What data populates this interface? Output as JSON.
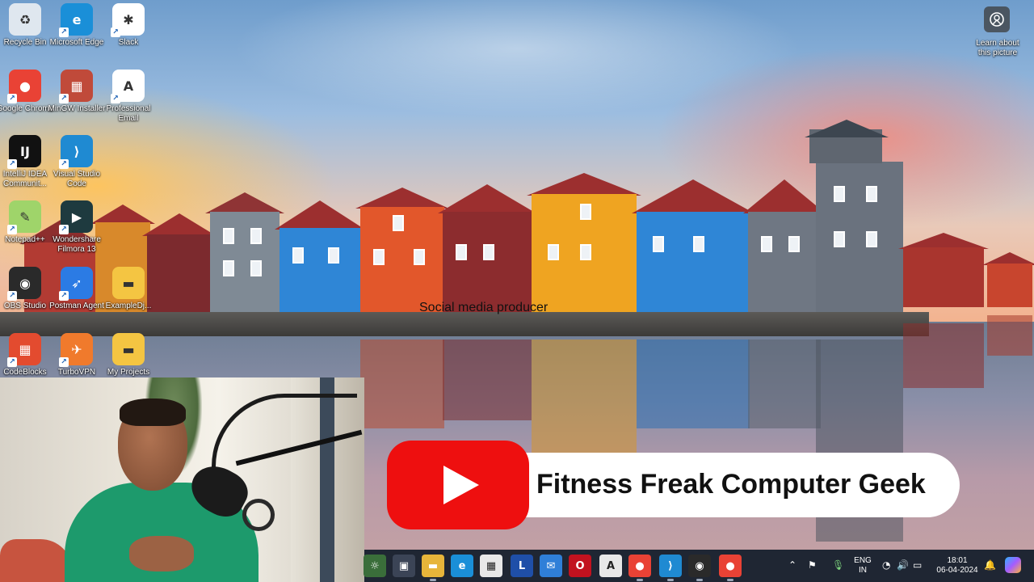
{
  "desktop": {
    "icons": [
      {
        "label": "Recycle Bin",
        "icon": "recycle-bin-icon",
        "color": "#dfe7ef"
      },
      {
        "label": "Microsoft Edge",
        "icon": "edge-icon",
        "color": "#1a8fd8"
      },
      {
        "label": "Slack",
        "icon": "slack-icon",
        "color": "#ffffff"
      },
      {
        "label": "Google Chrome",
        "icon": "chrome-icon",
        "color": "#e94235"
      },
      {
        "label": "MinGW Installer",
        "icon": "mingw-icon",
        "color": "#c04a3a"
      },
      {
        "label": "Professional Email",
        "icon": "email-icon",
        "color": "#ffffff"
      },
      {
        "label": "IntelliJ IDEA Communit...",
        "icon": "intellij-icon",
        "color": "#111111"
      },
      {
        "label": "Visual Studio Code",
        "icon": "vscode-icon",
        "color": "#1f8ad2"
      },
      {
        "label": "Notepad++",
        "icon": "notepadpp-icon",
        "color": "#9fd46a"
      },
      {
        "label": "Wondershare Filmora 13",
        "icon": "filmora-icon",
        "color": "#1e3a3f"
      },
      {
        "label": "OBS Studio",
        "icon": "obs-icon",
        "color": "#2a2a2a"
      },
      {
        "label": "Postman Agent",
        "icon": "postman-icon",
        "color": "#2b7be4"
      },
      {
        "label": "ExampleDj...",
        "icon": "folder-icon",
        "color": "#f4c542"
      },
      {
        "label": "CodeBlocks",
        "icon": "codeblocks-icon",
        "color": "#e34b2f"
      },
      {
        "label": "TurboVPN",
        "icon": "turbovpn-icon",
        "color": "#f07a2c"
      },
      {
        "label": "My Projects",
        "icon": "folder-icon",
        "color": "#f4c542"
      }
    ],
    "learn_label": "Learn about this picture",
    "float_text": "Social media producer"
  },
  "banner": {
    "channel_name": "Fitness Freak Computer Geek",
    "logo_color": "#ee0f0f"
  },
  "taskbar": {
    "apps": [
      {
        "name": "widgets-icon",
        "glyph": "☼",
        "bg": "#3a6e3a"
      },
      {
        "name": "task-view-icon",
        "glyph": "▣",
        "bg": "#3b4456"
      },
      {
        "name": "file-explorer-icon",
        "glyph": "▬",
        "bg": "#e7b53a"
      },
      {
        "name": "edge-taskbar-icon",
        "glyph": "e",
        "bg": "#1a8fd8"
      },
      {
        "name": "store-icon",
        "glyph": "▦",
        "bg": "#e8e8e8"
      },
      {
        "name": "l-app-icon",
        "glyph": "L",
        "bg": "#1f4fa8"
      },
      {
        "name": "mail-icon",
        "glyph": "✉",
        "bg": "#2f7fd8"
      },
      {
        "name": "opera-icon",
        "glyph": "O",
        "bg": "#c2121f"
      },
      {
        "name": "professional-email-taskbar-icon",
        "glyph": "A",
        "bg": "#e8e8e8"
      },
      {
        "name": "chrome-taskbar-icon",
        "glyph": "●",
        "bg": "#e94235"
      },
      {
        "name": "vscode-taskbar-icon",
        "glyph": "⟩",
        "bg": "#1f8ad2"
      },
      {
        "name": "obs-taskbar-icon",
        "glyph": "◉",
        "bg": "#2a2a2a"
      },
      {
        "name": "chrome-taskbar-icon-2",
        "glyph": "●",
        "bg": "#e94235"
      }
    ],
    "language_line1": "ENG",
    "language_line2": "IN",
    "time": "18:01",
    "date": "06-04-2024"
  }
}
